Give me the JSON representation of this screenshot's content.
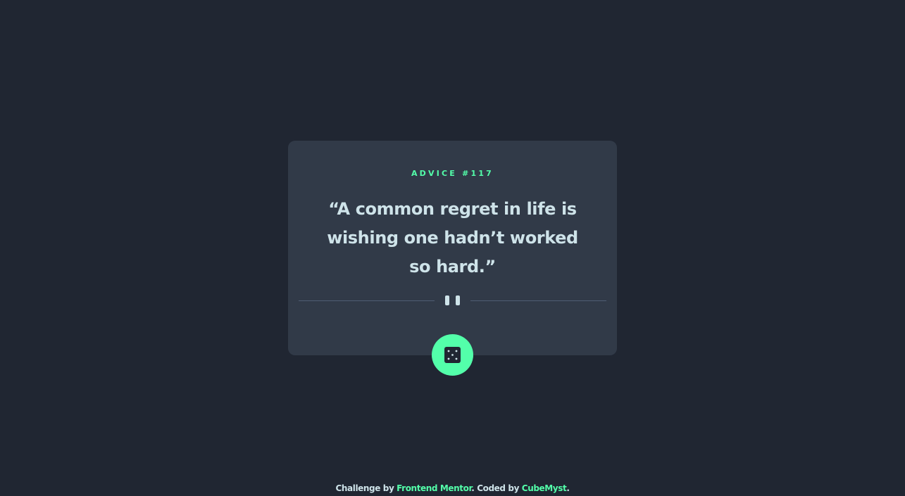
{
  "advice": {
    "label": "ADVICE #117",
    "quote": "“A common regret in life is wishing one hadn’t worked so hard.”"
  },
  "icons": {
    "divider": "pause-icon",
    "button": "dice-icon"
  },
  "footer": {
    "prefix": "Challenge by ",
    "challenge_link": "Frontend Mentor",
    "middle": ". Coded by ",
    "author_link": "CubeMyst",
    "suffix": "."
  },
  "colors": {
    "background": "#202632",
    "card": "#313a48",
    "accent": "#53ffaa",
    "text": "#cee3e9",
    "divider": "#4f5d74"
  }
}
